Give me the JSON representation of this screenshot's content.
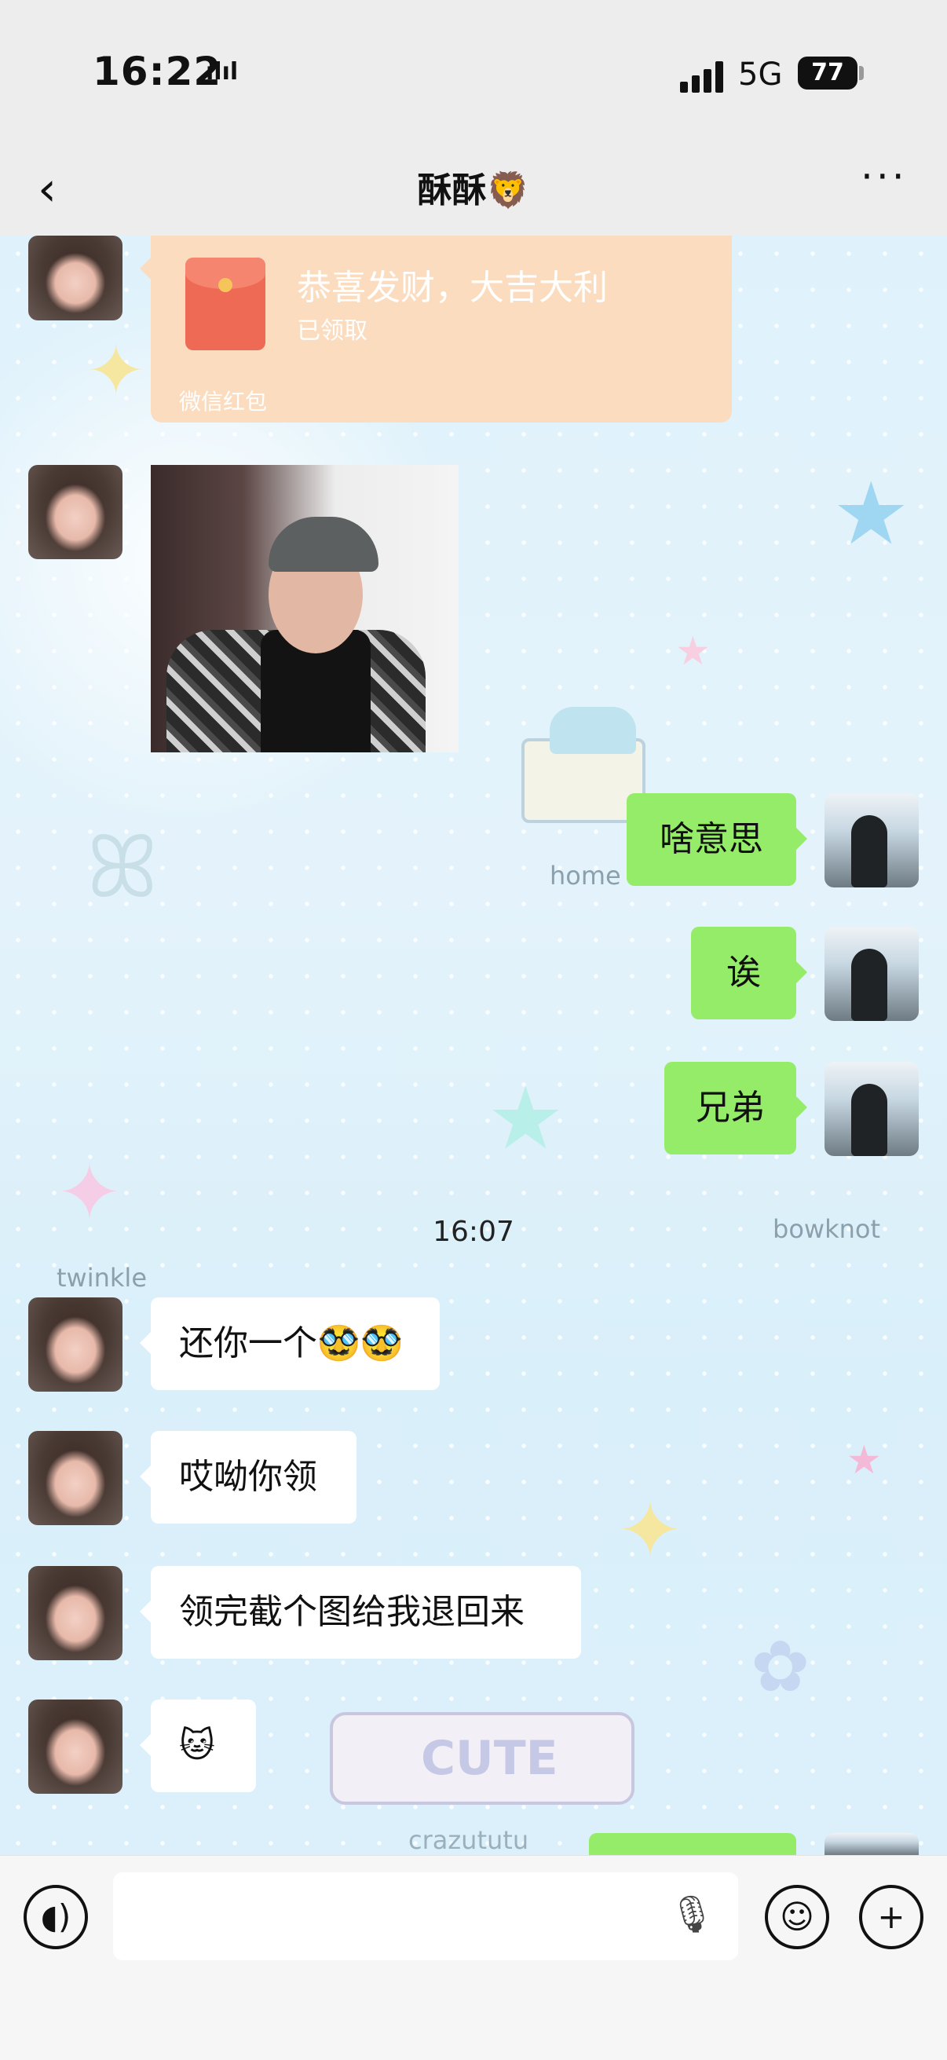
{
  "status_bar": {
    "time": "16:22",
    "time_suffix_icon": "app-notification-icon",
    "network": "5G",
    "battery": "77"
  },
  "header": {
    "title": "酥酥🦁",
    "back_icon": "chevron-left-icon",
    "more_icon": "more-dots-icon"
  },
  "red_packet": {
    "title": "恭喜发财，大吉大利",
    "status": "已领取",
    "source": "微信红包"
  },
  "messages": [
    {
      "side": "right",
      "text": "啥意思"
    },
    {
      "side": "right",
      "text": "诶"
    },
    {
      "side": "right",
      "text": "兄弟"
    }
  ],
  "timestamp": "16:07",
  "incoming": [
    {
      "text": "还你一个🥸🥸"
    },
    {
      "text": "哎呦你领"
    },
    {
      "text": "领完截个图给我退回来"
    },
    {
      "text": "🐱"
    }
  ],
  "wallpaper_labels": {
    "home": "home",
    "bowknot": "bowknot",
    "twinkle": "twinkle",
    "cute": "CUTE",
    "crazututu": "crazututu"
  },
  "input_bar": {
    "voice_icon": "voice-mode-icon",
    "mic_icon": "microphone-icon",
    "emoji_icon": "emoji-icon",
    "plus_icon": "plus-icon"
  }
}
